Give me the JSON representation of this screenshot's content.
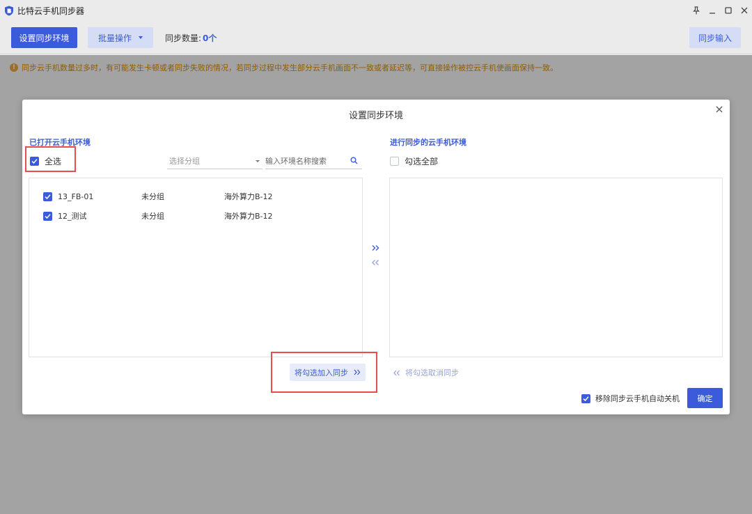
{
  "window": {
    "title": "比特云手机同步器",
    "icons": [
      "shield-logo-icon",
      "pin-icon",
      "minimize-icon",
      "maximize-icon",
      "close-icon"
    ]
  },
  "toolbar": {
    "setup_env_label": "设置同步环境",
    "batch_label": "批量操作",
    "sync_count_label": "同步数量:",
    "sync_count_value": "0个",
    "sync_input_label": "同步输入"
  },
  "warning": {
    "text": "同步云手机数量过多时，有可能发生卡顿或者同步失败的情况，若同步过程中发生部分云手机画面不一致或者延迟等，可直接操作被控云手机使画面保持一致。"
  },
  "dialog": {
    "title": "设置同步环境",
    "left": {
      "section_title": "已打开云手机环境",
      "select_all_label": "全选",
      "select_all_checked": true,
      "group_placeholder": "选择分组",
      "search_placeholder": "输入环境名称搜索",
      "rows": [
        {
          "name": "13_FB-01",
          "group": "未分组",
          "spec": "海外算力B-12",
          "checked": true
        },
        {
          "name": "12_测试",
          "group": "未分组",
          "spec": "海外算力B-12",
          "checked": true
        }
      ],
      "add_button_label": "将勾选加入同步"
    },
    "right": {
      "section_title": "进行同步的云手机环境",
      "check_all_label": "勾选全部",
      "check_all_checked": false,
      "remove_button_label": "将勾选取消同步"
    },
    "footer": {
      "auto_shutdown_label": "移除同步云手机自动关机",
      "auto_shutdown_checked": true,
      "confirm_label": "确定"
    }
  },
  "colors": {
    "accent": "#3b5bdb",
    "accent_light": "#e8ecfa",
    "warning": "#d48806",
    "highlight": "#e84c4c"
  }
}
